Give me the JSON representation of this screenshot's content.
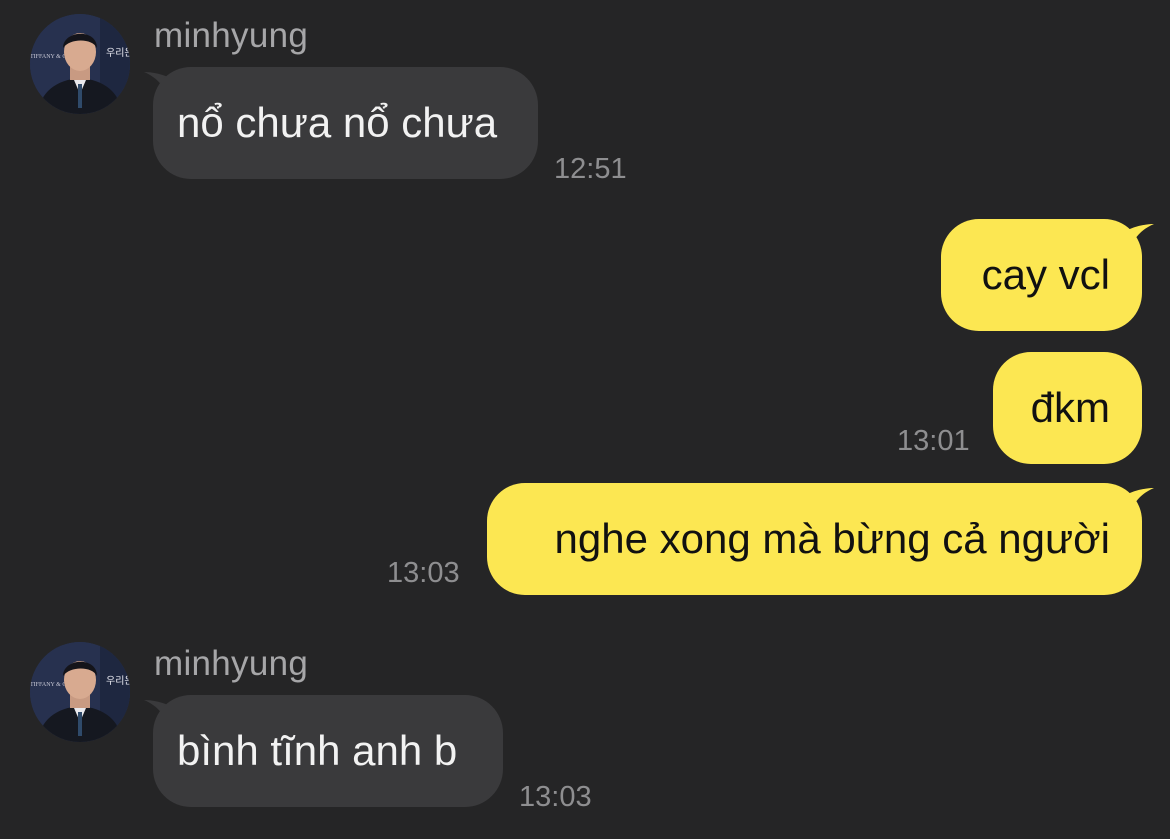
{
  "conversation": {
    "messages": [
      {
        "sender": "minhyung",
        "text": "nổ chưa nổ chưa",
        "time": "12:51"
      },
      {
        "sender": "me",
        "text": "cay vcl",
        "time": ""
      },
      {
        "sender": "me",
        "text": "đkm",
        "time": "13:01"
      },
      {
        "sender": "me",
        "text": "nghe xong mà bừng cả người",
        "time": "13:03"
      },
      {
        "sender": "minhyung",
        "text": "bình tĩnh anh b",
        "time": "13:03"
      }
    ]
  },
  "colors": {
    "background": "#252526",
    "incoming_bubble": "#3a3a3c",
    "outgoing_bubble": "#fce752"
  },
  "avatar_photo_text": {
    "banner_korean": "우리은행",
    "banner_latin": "TIFFANY & Co."
  }
}
